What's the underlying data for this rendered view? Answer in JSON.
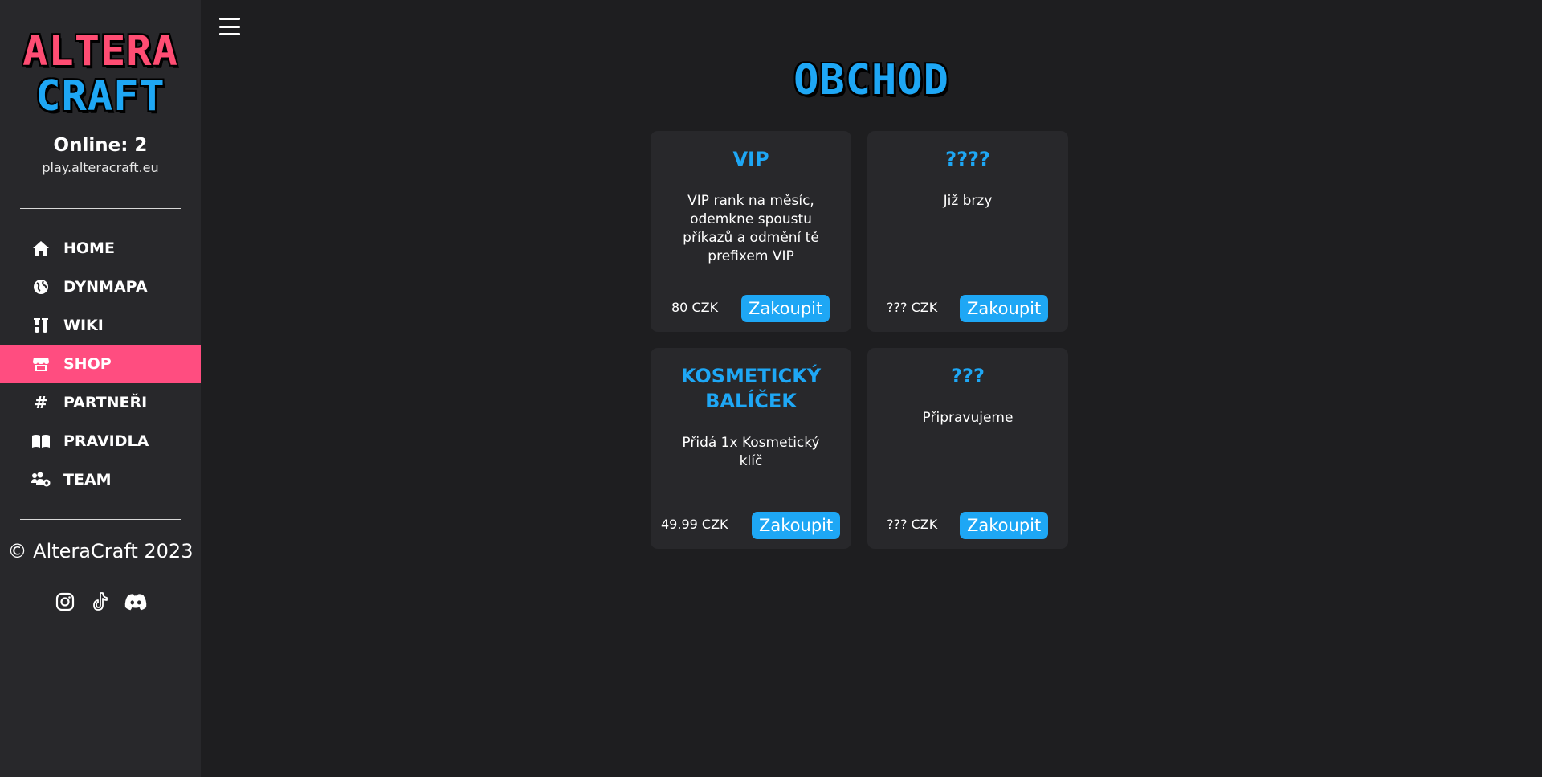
{
  "logo": {
    "line1": "ALTERA",
    "line2": "CRAFT"
  },
  "status": {
    "online": "Online: 2",
    "server": "play.alteracraft.eu"
  },
  "nav": [
    {
      "label": "HOME",
      "icon": "home-icon",
      "active": false
    },
    {
      "label": "DYNMAPA",
      "icon": "globe-icon",
      "active": false
    },
    {
      "label": "WIKI",
      "icon": "flask-icon",
      "active": false
    },
    {
      "label": "SHOP",
      "icon": "store-icon",
      "active": true
    },
    {
      "label": "PARTNEŘI",
      "icon": "hashtag-icon",
      "active": false
    },
    {
      "label": "PRAVIDLA",
      "icon": "book-icon",
      "active": false
    },
    {
      "label": "TEAM",
      "icon": "users-gear-icon",
      "active": false
    }
  ],
  "footer": {
    "copyright": "© AlteraCraft 2023"
  },
  "socials": [
    "instagram-icon",
    "tiktok-icon",
    "discord-icon"
  ],
  "page": {
    "title": "OBCHOD"
  },
  "products": [
    {
      "title": "VIP",
      "description": "VIP rank na měsíc, odemkne spoustu příkazů a odmění tě prefixem VIP",
      "price": "80 CZK",
      "button": "Zakoupit"
    },
    {
      "title": "????",
      "description": "Již brzy",
      "price": "??? CZK",
      "button": "Zakoupit"
    },
    {
      "title": "KOSMETICKÝ BALÍČEK",
      "description": "Přidá 1x Kosmetický klíč",
      "price": "49.99 CZK",
      "button": "Zakoupit"
    },
    {
      "title": "???",
      "description": "Připravujeme",
      "price": "??? CZK",
      "button": "Zakoupit"
    }
  ],
  "colors": {
    "accent_pink": "#ff4d80",
    "accent_blue": "#1ea7f5",
    "sidebar_bg": "#28282b",
    "page_bg": "#1e1e20"
  }
}
